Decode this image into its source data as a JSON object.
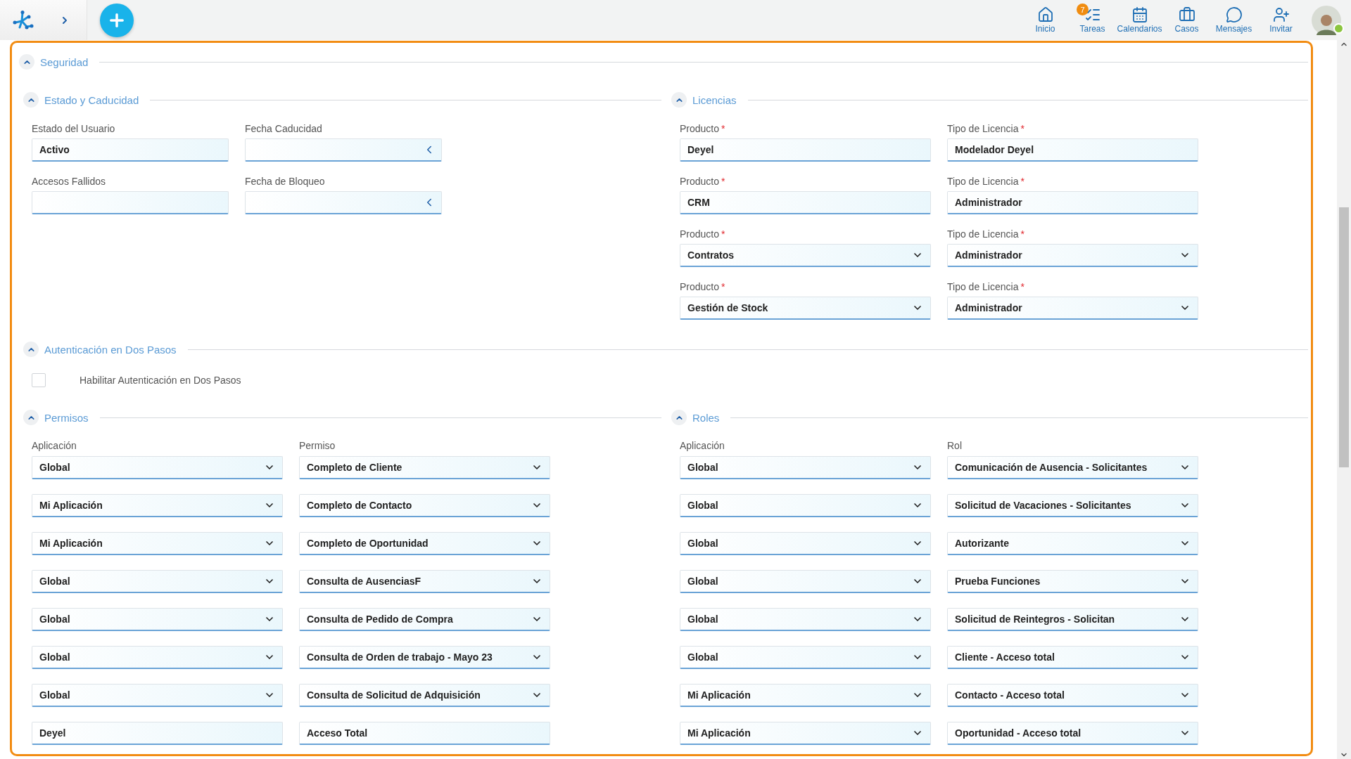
{
  "topbar": {
    "nav": [
      {
        "label": "Inicio"
      },
      {
        "label": "Tareas",
        "badge": "7"
      },
      {
        "label": "Calendarios"
      },
      {
        "label": "Casos"
      },
      {
        "label": "Mensajes"
      },
      {
        "label": "Invitar"
      }
    ],
    "avatar": {
      "online": true
    }
  },
  "section": {
    "title": "Seguridad",
    "expanded": true
  },
  "estado": {
    "title": "Estado y Caducidad",
    "expanded": true,
    "fields": [
      {
        "label": "Estado del Usuario",
        "kind": "text",
        "value": "Activo"
      },
      {
        "label": "Fecha Caducidad",
        "kind": "date"
      },
      {
        "label": "Accesos Fallidos",
        "kind": "text"
      },
      {
        "label": "Fecha de Bloqueo",
        "kind": "date"
      }
    ]
  },
  "licencias": {
    "title": "Licencias",
    "expanded": true,
    "fields": [
      {
        "label": "Producto",
        "required_mark": "*",
        "kind": "text",
        "value": "Deyel"
      },
      {
        "label": "Tipo de Licencia",
        "required_mark": "*",
        "kind": "text",
        "value": "Modelador Deyel"
      },
      {
        "label": "Producto",
        "required_mark": "*",
        "kind": "text",
        "value": "CRM"
      },
      {
        "label": "Tipo de Licencia",
        "required_mark": "*",
        "kind": "text",
        "value": "Administrador"
      },
      {
        "label": "Producto",
        "required_mark": "*",
        "kind": "select",
        "value": "Contratos"
      },
      {
        "label": "Tipo de Licencia",
        "required_mark": "*",
        "kind": "select",
        "value": "Administrador"
      },
      {
        "label": "Producto",
        "required_mark": "*",
        "kind": "select",
        "value": "Gestión de Stock"
      },
      {
        "label": "Tipo de Licencia",
        "required_mark": "*",
        "kind": "select",
        "value": "Administrador"
      }
    ]
  },
  "autenticacion": {
    "title": "Autenticación en Dos Pasos",
    "expanded": true,
    "checkbox": {
      "label": "Habilitar Autenticación en Dos Pasos",
      "checked": false
    }
  },
  "permisos": {
    "title": "Permisos",
    "expanded": true,
    "columns": [
      "Aplicación",
      "Permiso"
    ],
    "rows": [
      {
        "kind": "select",
        "cells": [
          "Global",
          "Completo de Cliente"
        ]
      },
      {
        "kind": "select",
        "cells": [
          "Mi Aplicación",
          "Completo de Contacto"
        ]
      },
      {
        "kind": "select",
        "cells": [
          "Mi Aplicación",
          "Completo de Oportunidad"
        ]
      },
      {
        "kind": "select",
        "cells": [
          "Global",
          "Consulta de AusenciasF"
        ]
      },
      {
        "kind": "select",
        "cells": [
          "Global",
          "Consulta de Pedido de Compra"
        ]
      },
      {
        "kind": "select",
        "cells": [
          "Global",
          "Consulta de Orden de trabajo - Mayo 23"
        ]
      },
      {
        "kind": "select",
        "cells": [
          "Global",
          "Consulta de Solicitud de Adquisición"
        ]
      },
      {
        "kind": "text",
        "cells": [
          "Deyel",
          "Acceso Total"
        ]
      }
    ]
  },
  "roles": {
    "title": "Roles",
    "expanded": true,
    "columns": [
      "Aplicación",
      "Rol"
    ],
    "rows": [
      {
        "kind": "select",
        "cells": [
          "Global",
          "Comunicación de Ausencia - Solicitantes"
        ]
      },
      {
        "kind": "select",
        "cells": [
          "Global",
          "Solicitud de Vacaciones - Solicitantes"
        ]
      },
      {
        "kind": "select",
        "cells": [
          "Global",
          "Autorizante"
        ]
      },
      {
        "kind": "select",
        "cells": [
          "Global",
          "Prueba Funciones"
        ]
      },
      {
        "kind": "select",
        "cells": [
          "Global",
          "Solicitud de Reintegros - Solicitan"
        ]
      },
      {
        "kind": "select",
        "cells": [
          "Global",
          "Cliente - Acceso total"
        ]
      },
      {
        "kind": "select",
        "cells": [
          "Mi Aplicación",
          "Contacto - Acceso total"
        ]
      },
      {
        "kind": "select",
        "cells": [
          "Mi Aplicación",
          "Oportunidad - Acceso total"
        ]
      }
    ]
  }
}
